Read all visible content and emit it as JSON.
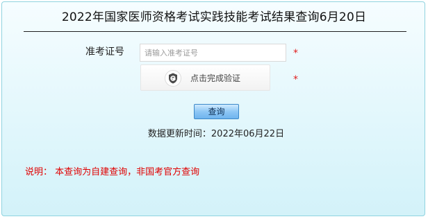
{
  "page_title": "2022年国家医师资格考试实践技能考试结果查询6月20日",
  "form": {
    "exam_number_label": "准考证号",
    "exam_number_placeholder": "请输入准考证号",
    "exam_number_value": "",
    "required_mark": "*",
    "captcha_label": "点击完成验证",
    "captcha_icon": "shield-check-icon",
    "query_button_label": "查询"
  },
  "update_time_text": "数据更新时间：2022年06月22日",
  "note_text": "说明：  本查询为自建查询，非国考官方查询",
  "colors": {
    "panel_bg": "#e2f7fc",
    "panel_border": "#8fd3df",
    "required": "#e02020",
    "note": "#e00000",
    "button": "#8ec7f5"
  }
}
